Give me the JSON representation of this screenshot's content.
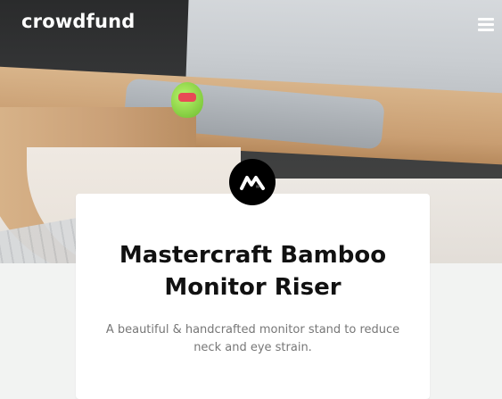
{
  "header": {
    "brand": "crowdfund",
    "menu_icon": "hamburger-menu-icon"
  },
  "hero": {
    "image": "bamboo-monitor-riser-photo"
  },
  "project": {
    "logo_icon": "mastercraft-logo-icon",
    "title_line1": "Mastercraft Bamboo",
    "title_line2": "Monitor Riser",
    "description": "A beautiful & handcrafted monitor stand to reduce neck and eye strain."
  },
  "colors": {
    "page_background": "#f2f3f2",
    "card_background": "#ffffff",
    "title_text": "#111111",
    "body_text": "#777777",
    "brand_text": "#ffffff",
    "logo_badge": "#000000"
  }
}
